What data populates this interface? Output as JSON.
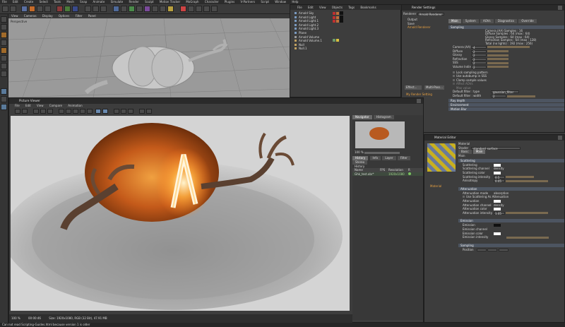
{
  "app": {
    "menu": [
      "File",
      "Edit",
      "Create",
      "Select",
      "Tools",
      "Mesh",
      "Snap",
      "Animate",
      "Simulate",
      "Render",
      "Sculpt",
      "Motion Tracker",
      "MoGraph",
      "Character",
      "Plugins",
      "V-Partners",
      "Script",
      "Window",
      "Help"
    ]
  },
  "viewport": {
    "menu": [
      "View",
      "Cameras",
      "Display",
      "Options",
      "Filter",
      "Panel"
    ],
    "label": "Perspective"
  },
  "object_manager": {
    "menu": [
      "File",
      "Edit",
      "View",
      "Objects",
      "Tags",
      "Bookmarks"
    ],
    "objects": [
      "Arnold Sky",
      "Arnold Light",
      "Arnold Light.1",
      "Arnold Light.2",
      "Arnold Light.3",
      "Plane",
      "Arnold Volume",
      "Arnold Volume.1",
      "Null",
      "Null.1"
    ]
  },
  "render_settings": {
    "title": "Render Settings",
    "renderer_label": "Renderer",
    "renderer_value": "Arnold Renderer",
    "left_items": [
      "Output",
      "Save",
      "Arnold Renderer"
    ],
    "tabs": [
      "Main",
      "System",
      "AOVs",
      "Diagnostics",
      "Override"
    ],
    "section_sampling": "Sampling",
    "sampling_info": [
      "Camera (AA) Samples : 16",
      "Diffuse Samples : 64 (max : 64)",
      "Glossy Samples : 64 (max : 64)",
      "Refraction Samples : 64 (max : 128)",
      "Total (no lights) : 192 (max : 256)"
    ],
    "params": [
      {
        "label": "Camera (AA)",
        "value": "4"
      },
      {
        "label": "Diffuse",
        "value": "2"
      },
      {
        "label": "Glossy",
        "value": "2"
      },
      {
        "label": "Refraction",
        "value": "2"
      },
      {
        "label": "SSS",
        "value": "2"
      },
      {
        "label": "Volume Indirect",
        "value": "2"
      }
    ],
    "options": [
      "Lock sampling pattern",
      "Use autobump in SSS",
      "Clamp sample values",
      "Affect AOVs",
      "Max value"
    ],
    "filter": [
      {
        "label": "Default filter : type",
        "value": "gaussian_filter"
      },
      {
        "label": "Default filter : width",
        "value": "2"
      }
    ],
    "sections": [
      "Ray depth",
      "Environment",
      "Motion Blur"
    ],
    "effect_label": "Effect...",
    "multipass_label": "Multi-Pass...",
    "my_render_setting": "My Render Setting"
  },
  "picture_viewer": {
    "title": "Picture Viewer",
    "menu": [
      "File",
      "Edit",
      "View",
      "Compare",
      "Animation"
    ],
    "tabs": [
      "Navigator",
      "Histogram"
    ],
    "zoom": "100 %",
    "history_tabs": [
      "History",
      "Info",
      "Layer",
      "Filter",
      "Stereo"
    ],
    "history_label": "History",
    "columns": [
      "Name",
      "FPS",
      "Resolution",
      "R"
    ],
    "history_row": {
      "name": "Ghk_test.obr*",
      "fps": "",
      "resolution": "1920x1080"
    },
    "status": "100 %",
    "status_detail": "Size: 1920x1080, RGB (32 Bit), 47.91 MB",
    "time": "00:00:46"
  },
  "material_editor": {
    "title": "Material Editor",
    "material_label": "Material",
    "shader_label": "Shader",
    "shader_value": "standard_surface",
    "preview_name": "Material",
    "tabs": [
      "Basic",
      "Main"
    ],
    "section_main": "Main",
    "groups": [
      {
        "name": "Scattering",
        "rows": [
          "Scattering",
          "Scattering channel",
          "Scattering color",
          "Scattering intensity",
          "Anisotropy"
        ]
      },
      {
        "name": "Attenuation",
        "rows": [
          "Attenuation mode",
          "Use Scattering As Attenuation",
          "Attenuation",
          "Attenuation channel",
          "Attenuation color",
          "Attenuation intensity"
        ]
      },
      {
        "name": "Emission",
        "rows": [
          "Emission",
          "Emission channel",
          "Emission color",
          "Emission intensity"
        ]
      },
      {
        "name": "Sampling",
        "rows": [
          "Position"
        ]
      }
    ],
    "values": {
      "scattering_channel": "density",
      "scattering_intensity": "0.5",
      "anisotropy": "0.05",
      "attenuation_mode": "absorption",
      "attenuation_channel": "density",
      "attenuation_intensity": "1.05"
    }
  },
  "statusbar": {
    "text": "Can not read Scripting-Guides.html because version 1 is older"
  },
  "colors": {
    "accent": "#e07b1a",
    "panel": "#3d3d3d",
    "header": "#2a2a2a"
  }
}
